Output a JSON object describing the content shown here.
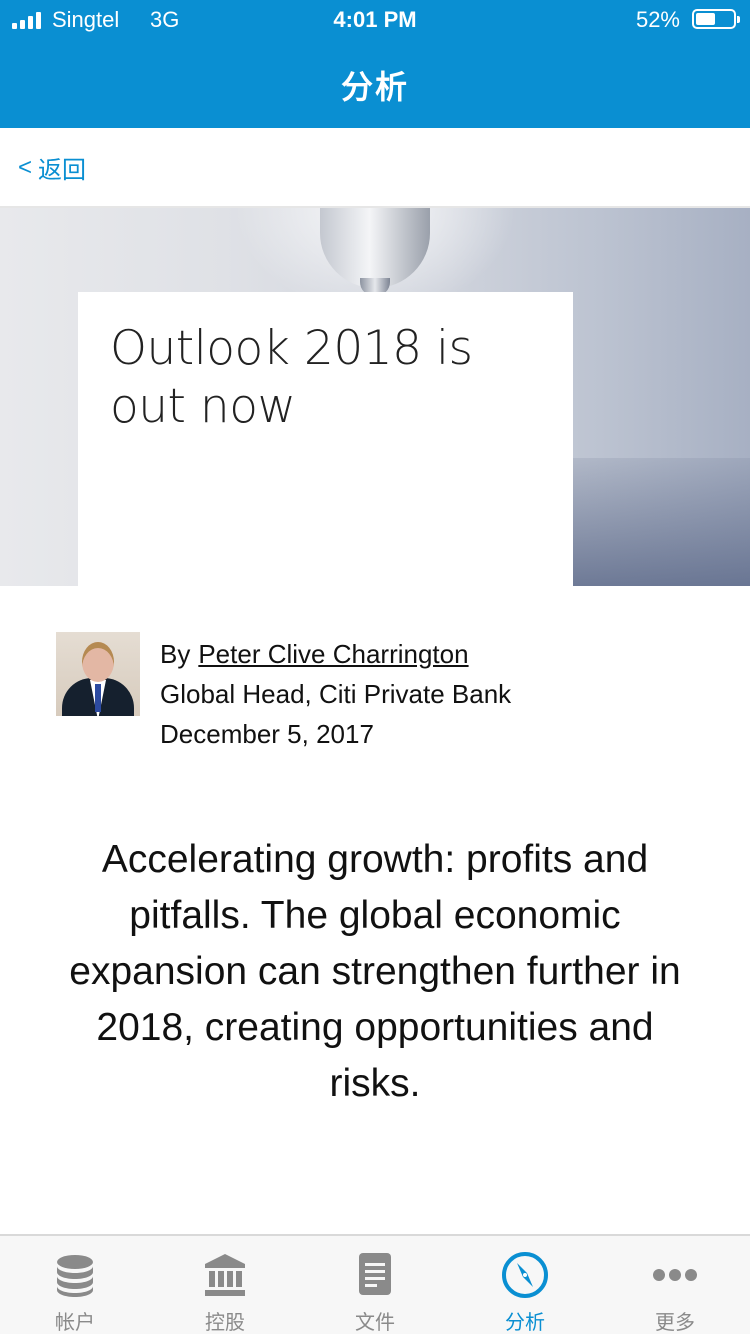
{
  "status_bar": {
    "carrier": "Singtel",
    "network": "3G",
    "time": "4:01 PM",
    "battery": "52%",
    "battery_level": 0.52
  },
  "nav": {
    "title": "分析",
    "back_label": "返回"
  },
  "hero": {
    "title": "Outlook 2018 is out now"
  },
  "article": {
    "by_prefix": "By",
    "author_name": "Peter Clive Charrington",
    "author_title": "Global Head, Citi Private Bank",
    "date": "December 5, 2017",
    "summary": "Accelerating growth: profits and pitfalls. The global economic expansion can strengthen further in 2018, creating opportunities and risks."
  },
  "tabs": [
    {
      "label": "帐户",
      "icon": "database-icon",
      "active": false
    },
    {
      "label": "控股",
      "icon": "bank-icon",
      "active": false
    },
    {
      "label": "文件",
      "icon": "document-icon",
      "active": false
    },
    {
      "label": "分析",
      "icon": "compass-icon",
      "active": true
    },
    {
      "label": "更多",
      "icon": "more-icon",
      "active": false
    }
  ],
  "colors": {
    "accent": "#0a8fd2",
    "tab_inactive": "#8a8a8a"
  }
}
